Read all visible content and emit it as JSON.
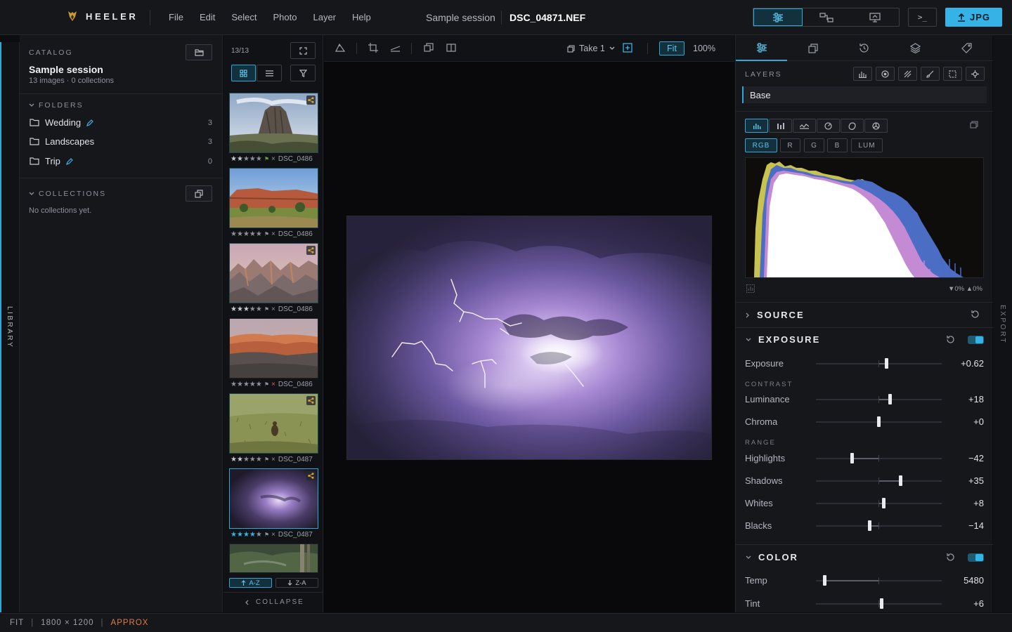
{
  "app": {
    "name": "HEELER"
  },
  "menu": [
    "File",
    "Edit",
    "Select",
    "Photo",
    "Layer",
    "Help"
  ],
  "session": {
    "name": "Sample session",
    "file": "DSC_04871.NEF"
  },
  "export_label": "JPG",
  "terminal_label": ">_",
  "rails": {
    "left": "LIBRARY",
    "right": "EXPORT"
  },
  "catalog": {
    "label": "CATALOG",
    "title": "Sample session",
    "subtitle": "13 images · 0 collections",
    "folders_label": "FOLDERS",
    "folders": [
      {
        "name": "Wedding",
        "count": "3",
        "editable": true
      },
      {
        "name": "Landscapes",
        "count": "3",
        "editable": false
      },
      {
        "name": "Trip",
        "count": "0",
        "editable": true
      }
    ],
    "collections_label": "COLLECTIONS",
    "collections_empty": "No collections yet."
  },
  "filmstrip": {
    "count": "13/13",
    "items": [
      {
        "label": "DSC_0486",
        "stars": 2,
        "shared": true,
        "x": "×"
      },
      {
        "label": "DSC_0486",
        "stars": 0,
        "shared": false,
        "x": "×"
      },
      {
        "label": "DSC_0486",
        "stars": 3,
        "shared": true,
        "x": "×"
      },
      {
        "label": "DSC_0486",
        "stars": 0,
        "shared": false,
        "x": "×"
      },
      {
        "label": "DSC_0487",
        "stars": 2,
        "shared": true,
        "x": "×"
      },
      {
        "label": "DSC_0487",
        "stars": 4,
        "shared": true,
        "x": "×"
      }
    ],
    "sort_az": "A-Z",
    "sort_za": "Z-A",
    "collapse": "COLLAPSE"
  },
  "viewer": {
    "take": "Take 1",
    "fit": "Fit",
    "zoom": "100%"
  },
  "layers": {
    "label": "LAYERS",
    "base": "Base"
  },
  "channels": [
    "RGB",
    "R",
    "G",
    "B",
    "LUM"
  ],
  "histogram": {
    "clip": "▼0% ▲0%"
  },
  "sections": {
    "source": "SOURCE",
    "exposure": "EXPOSURE",
    "color": "COLOR",
    "contrast": "CONTRAST",
    "range": "RANGE"
  },
  "sliders": {
    "exposure": {
      "label": "Exposure",
      "value": "+0.62",
      "pos": 0.56
    },
    "luminance": {
      "label": "Luminance",
      "value": "+18",
      "pos": 0.59
    },
    "chroma": {
      "label": "Chroma",
      "value": "+0",
      "pos": 0.5
    },
    "highlights": {
      "label": "Highlights",
      "value": "−42",
      "pos": 0.29
    },
    "shadows": {
      "label": "Shadows",
      "value": "+35",
      "pos": 0.675
    },
    "whites": {
      "label": "Whites",
      "value": "+8",
      "pos": 0.54
    },
    "blacks": {
      "label": "Blacks",
      "value": "−14",
      "pos": 0.43
    },
    "temp": {
      "label": "Temp",
      "value": "5480",
      "pos": 0.07
    },
    "tint": {
      "label": "Tint",
      "value": "+6",
      "pos": 0.52
    }
  },
  "status": {
    "mode": "FIT",
    "size": "1800 × 1200",
    "flag": "APPROX"
  },
  "colors": {
    "accent": "#35b3e6",
    "warn": "#e07a4a"
  }
}
